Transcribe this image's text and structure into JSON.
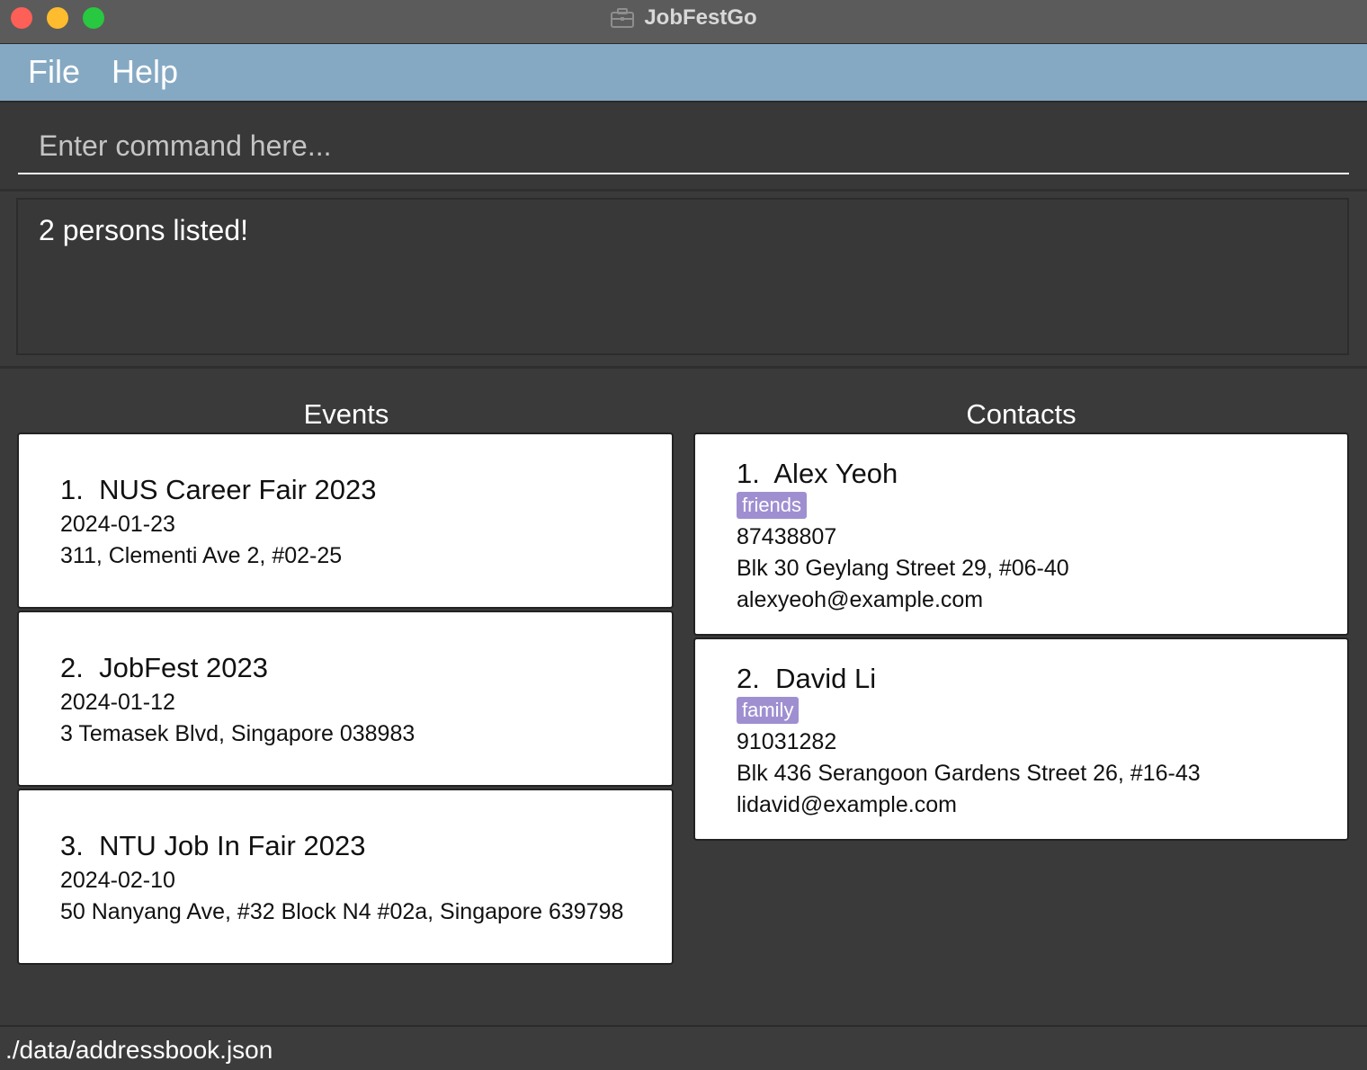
{
  "window": {
    "title": "JobFestGo",
    "title_icon": "briefcase-icon"
  },
  "menu": {
    "file": "File",
    "help": "Help"
  },
  "command": {
    "placeholder": "Enter command here..."
  },
  "result": {
    "text": "2 persons listed!"
  },
  "events": {
    "heading": "Events",
    "items": [
      {
        "index": "1.",
        "name": "NUS Career Fair 2023",
        "date": "2024-01-23",
        "address": "311, Clementi Ave 2, #02-25"
      },
      {
        "index": "2.",
        "name": "JobFest 2023",
        "date": "2024-01-12",
        "address": "3 Temasek Blvd, Singapore 038983"
      },
      {
        "index": "3.",
        "name": "NTU Job In Fair 2023",
        "date": "2024-02-10",
        "address": "50 Nanyang Ave, #32 Block N4 #02a, Singapore 639798"
      }
    ]
  },
  "contacts": {
    "heading": "Contacts",
    "items": [
      {
        "index": "1.",
        "name": "Alex Yeoh",
        "tag": "friends",
        "phone": "87438807",
        "address": "Blk 30 Geylang Street 29, #06-40",
        "email": "alexyeoh@example.com"
      },
      {
        "index": "2.",
        "name": "David Li",
        "tag": "family",
        "phone": "91031282",
        "address": "Blk 436 Serangoon Gardens Street 26, #16-43",
        "email": "lidavid@example.com"
      }
    ]
  },
  "status": {
    "path": "./data/addressbook.json"
  },
  "colors": {
    "menubar": "#85a9c3",
    "tag": "#9f8fd1",
    "background": "#3a3a3a"
  }
}
